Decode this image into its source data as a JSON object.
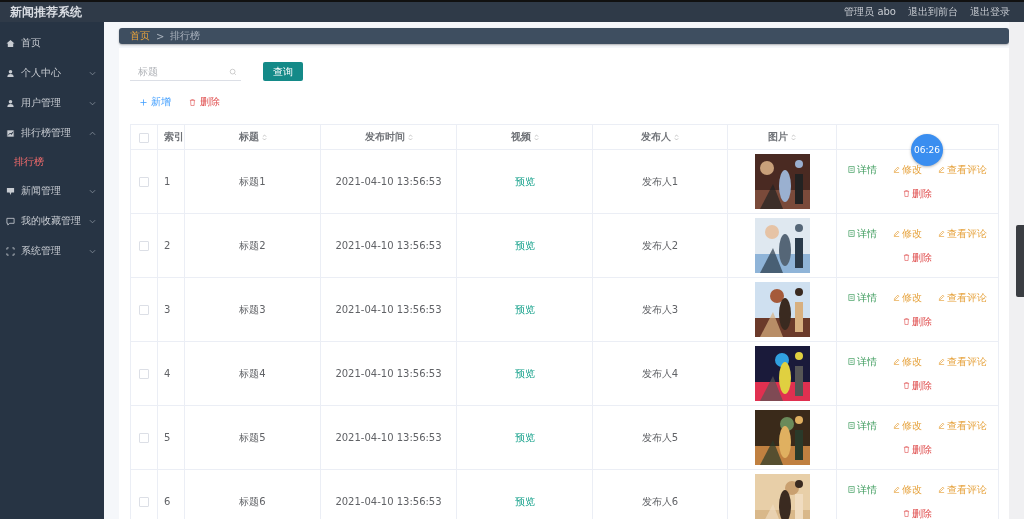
{
  "app_title": "新闻推荐系统",
  "header_links": [
    {
      "label": "管理员 abo"
    },
    {
      "label": "退出到前台"
    },
    {
      "label": "退出登录"
    }
  ],
  "sidebar": {
    "items": [
      {
        "label": "首页",
        "kind": "link"
      },
      {
        "label": "个人中心",
        "kind": "group",
        "expanded": false
      },
      {
        "label": "用户管理",
        "kind": "group",
        "expanded": false
      },
      {
        "label": "排行榜管理",
        "kind": "group",
        "expanded": true,
        "children": [
          {
            "label": "排行榜",
            "selected": true
          }
        ]
      },
      {
        "label": "新闻管理",
        "kind": "group",
        "expanded": false
      },
      {
        "label": "我的收藏管理",
        "kind": "group",
        "expanded": false
      },
      {
        "label": "系统管理",
        "kind": "group",
        "expanded": false
      }
    ]
  },
  "breadcrumb": [
    {
      "label": "首页",
      "current": false
    },
    {
      "label": ">",
      "kind": "sep"
    },
    {
      "label": "排行榜",
      "current": true
    }
  ],
  "search": {
    "placeholder": "标题",
    "button": "查询"
  },
  "toolbar": [
    {
      "kind": "add",
      "label": "新增"
    },
    {
      "kind": "delete",
      "label": "删除"
    }
  ],
  "table": {
    "header_checked": false,
    "columns": [
      {
        "label": "索引",
        "sortable": false
      },
      {
        "label": "标题",
        "sortable": true
      },
      {
        "label": "发布时间",
        "sortable": true
      },
      {
        "label": "视频",
        "sortable": true
      },
      {
        "label": "发布人",
        "sortable": true
      },
      {
        "label": "图片",
        "sortable": true
      }
    ],
    "rows": [
      {
        "checked": false,
        "index": "1",
        "title": "标题1",
        "time": "2021-04-10 13:56:53",
        "video": "预览",
        "publisher": "发布人1",
        "actions": [
          {
            "kind": "detail",
            "label": "详情"
          },
          {
            "kind": "edit",
            "label": "修改"
          },
          {
            "kind": "edit",
            "label": "查看评论"
          },
          {
            "kind": "delete",
            "label": "删除"
          }
        ]
      },
      {
        "checked": false,
        "index": "2",
        "title": "标题2",
        "time": "2021-04-10 13:56:53",
        "video": "预览",
        "publisher": "发布人2",
        "actions": [
          {
            "kind": "detail",
            "label": "详情"
          },
          {
            "kind": "edit",
            "label": "修改"
          },
          {
            "kind": "edit",
            "label": "查看评论"
          },
          {
            "kind": "delete",
            "label": "删除"
          }
        ]
      },
      {
        "checked": false,
        "index": "3",
        "title": "标题3",
        "time": "2021-04-10 13:56:53",
        "video": "预览",
        "publisher": "发布人3",
        "actions": [
          {
            "kind": "detail",
            "label": "详情"
          },
          {
            "kind": "edit",
            "label": "修改"
          },
          {
            "kind": "edit",
            "label": "查看评论"
          },
          {
            "kind": "delete",
            "label": "删除"
          }
        ]
      },
      {
        "checked": false,
        "index": "4",
        "title": "标题4",
        "time": "2021-04-10 13:56:53",
        "video": "预览",
        "publisher": "发布人4",
        "actions": [
          {
            "kind": "detail",
            "label": "详情"
          },
          {
            "kind": "edit",
            "label": "修改"
          },
          {
            "kind": "edit",
            "label": "查看评论"
          },
          {
            "kind": "delete",
            "label": "删除"
          }
        ]
      },
      {
        "checked": false,
        "index": "5",
        "title": "标题5",
        "time": "2021-04-10 13:56:53",
        "video": "预览",
        "publisher": "发布人5",
        "actions": [
          {
            "kind": "detail",
            "label": "详情"
          },
          {
            "kind": "edit",
            "label": "修改"
          },
          {
            "kind": "edit",
            "label": "查看评论"
          },
          {
            "kind": "delete",
            "label": "删除"
          }
        ]
      },
      {
        "checked": false,
        "index": "6",
        "title": "标题6",
        "time": "2021-04-10 13:56:53",
        "video": "预览",
        "publisher": "发布人6",
        "actions": [
          {
            "kind": "detail",
            "label": "详情"
          },
          {
            "kind": "edit",
            "label": "修改"
          },
          {
            "kind": "edit",
            "label": "查看评论"
          },
          {
            "kind": "delete",
            "label": "删除"
          }
        ]
      }
    ]
  },
  "timer": "06:26"
}
